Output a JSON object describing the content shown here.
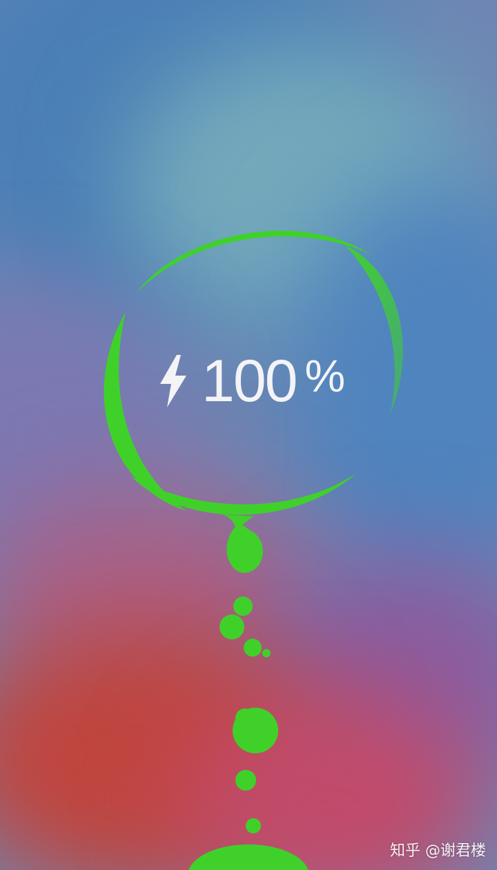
{
  "charging": {
    "icon": "lightning-bolt-icon",
    "percentage": "100",
    "percent_sign": "%",
    "level": 1.0
  },
  "colors": {
    "ring": "#3fd12a",
    "text": "#f4f4f6",
    "wallpaper_top": "#5c90b8",
    "wallpaper_bottom": "#c04a4a"
  },
  "watermark": {
    "text": "知乎 @谢君楼"
  }
}
